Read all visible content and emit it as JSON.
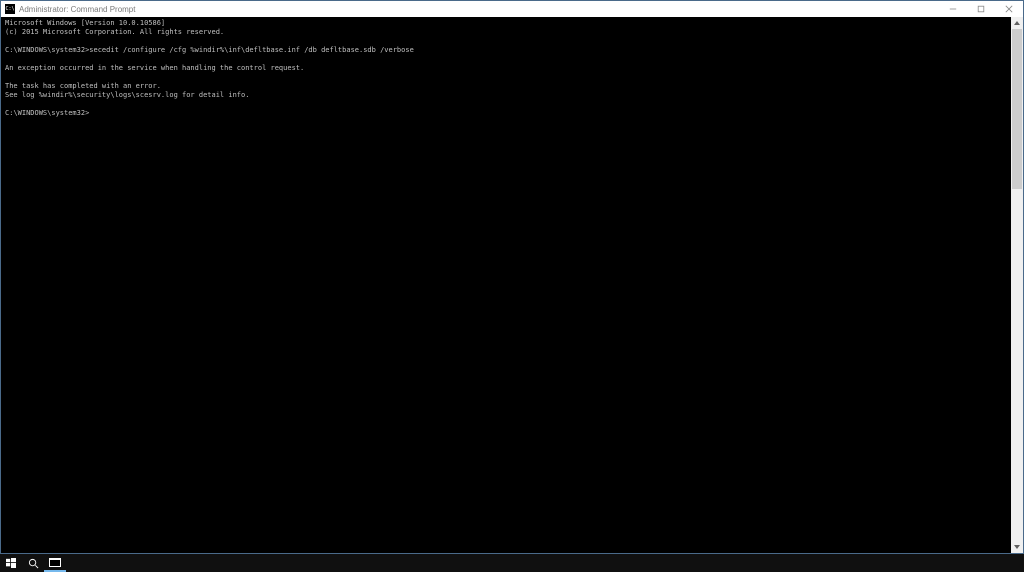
{
  "window": {
    "title": "Administrator: Command Prompt",
    "controls": {
      "minimize": "minimize",
      "maximize": "restore",
      "close": "close"
    }
  },
  "terminal": {
    "lines": [
      "Microsoft Windows [Version 10.0.10586]",
      "(c) 2015 Microsoft Corporation. All rights reserved.",
      "",
      "C:\\WINDOWS\\system32>secedit /configure /cfg %windir%\\inf\\defltbase.inf /db defltbase.sdb /verbose",
      "",
      "An exception occurred in the service when handling the control request.",
      "",
      "The task has completed with an error.",
      "See log %windir%\\security\\logs\\scesrv.log for detail info.",
      "",
      "C:\\WINDOWS\\system32>"
    ]
  },
  "taskbar": {
    "start": "start",
    "search": "search",
    "taskview": "task-view"
  }
}
